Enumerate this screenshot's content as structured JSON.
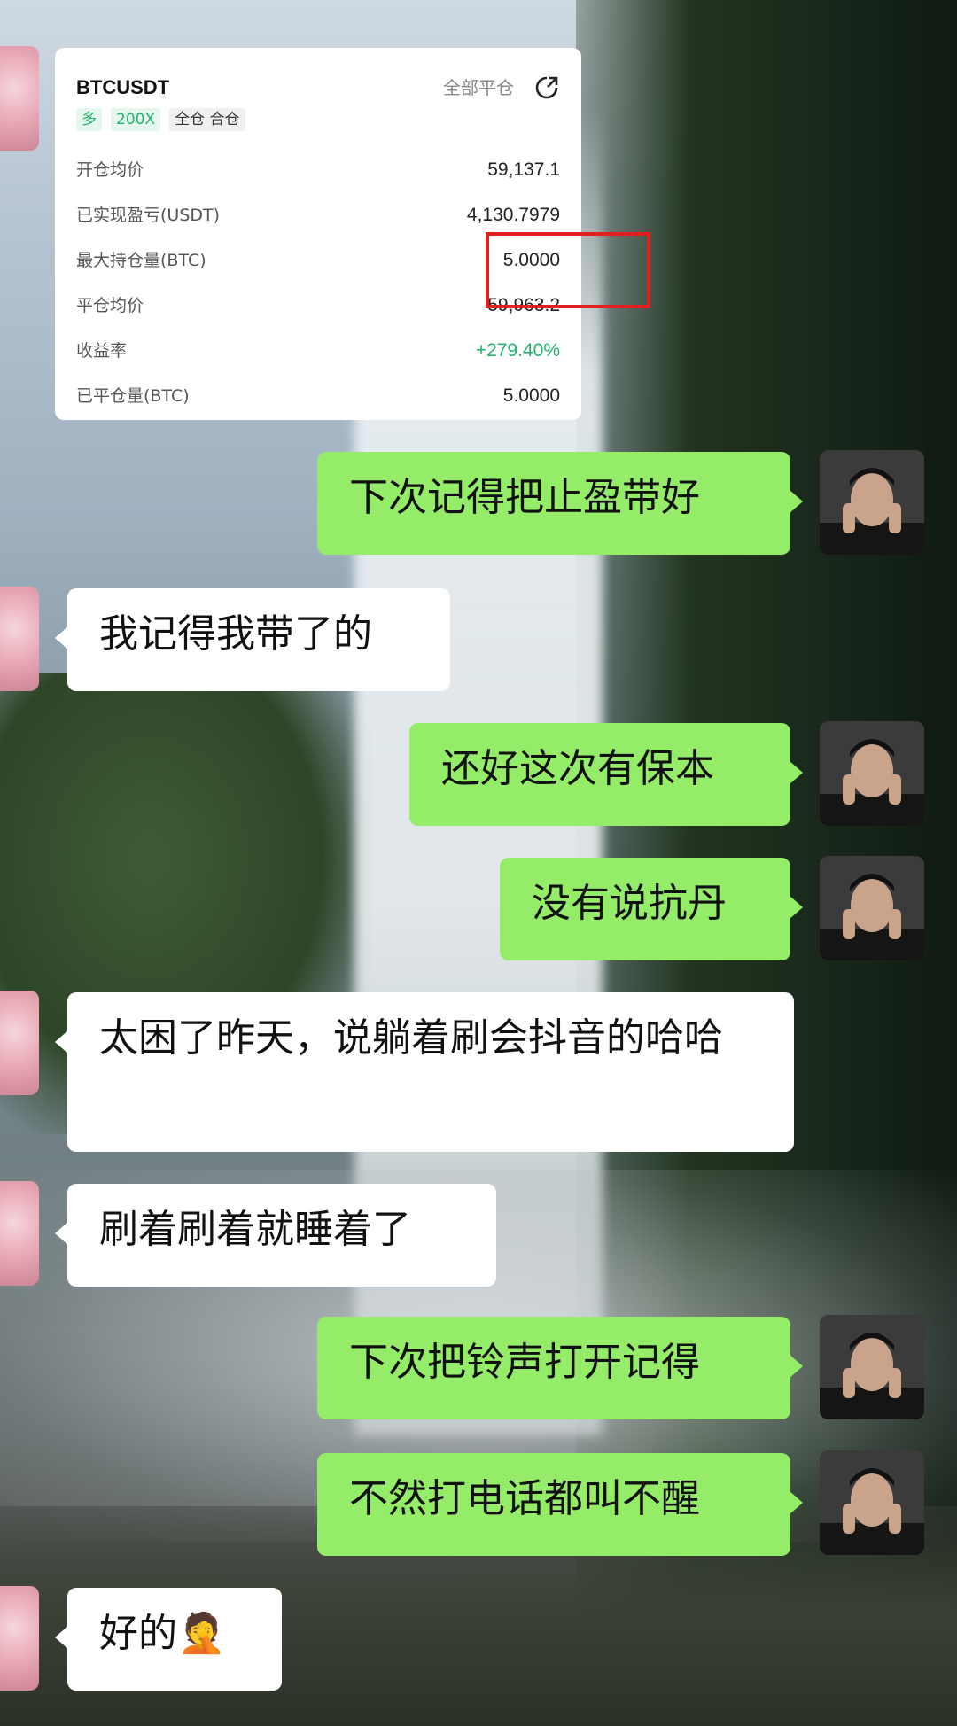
{
  "trade_card": {
    "symbol": "BTCUSDT",
    "close_all_label": "全部平仓",
    "share_icon": "share-icon",
    "tags": [
      "多",
      "200X",
      "全仓 合仓"
    ],
    "rows": [
      {
        "label": "开仓均价",
        "value": "59,137.1",
        "style": "normal"
      },
      {
        "label": "已实现盈亏(USDT)",
        "value": "4,130.7979",
        "style": "normal"
      },
      {
        "label": "最大持仓量(BTC)",
        "value": "5.0000",
        "style": "normal"
      },
      {
        "label": "平仓均价",
        "value": "59,963.2",
        "style": "normal"
      },
      {
        "label": "收益率",
        "value": "+279.40%",
        "style": "positive"
      },
      {
        "label": "已平仓量(BTC)",
        "value": "5.0000",
        "style": "normal"
      }
    ],
    "highlight_color": "#e01f1f"
  },
  "messages": [
    {
      "side": "right",
      "text": "下次记得把止盈带好"
    },
    {
      "side": "left",
      "text": "我记得我带了的"
    },
    {
      "side": "right",
      "text": "还好这次有保本"
    },
    {
      "side": "right",
      "text": "没有说抗丹"
    },
    {
      "side": "left",
      "text": "太困了昨天，说躺着刷会抖音的哈哈"
    },
    {
      "side": "left",
      "text": "刷着刷着就睡着了"
    },
    {
      "side": "right",
      "text": "下次把铃声打开记得"
    },
    {
      "side": "right",
      "text": "不然打电话都叫不醒"
    },
    {
      "side": "left",
      "text": "好的🤦"
    }
  ],
  "colors": {
    "sent_bubble": "#95ec69",
    "received_bubble": "#ffffff",
    "positive": "#23b26d"
  }
}
